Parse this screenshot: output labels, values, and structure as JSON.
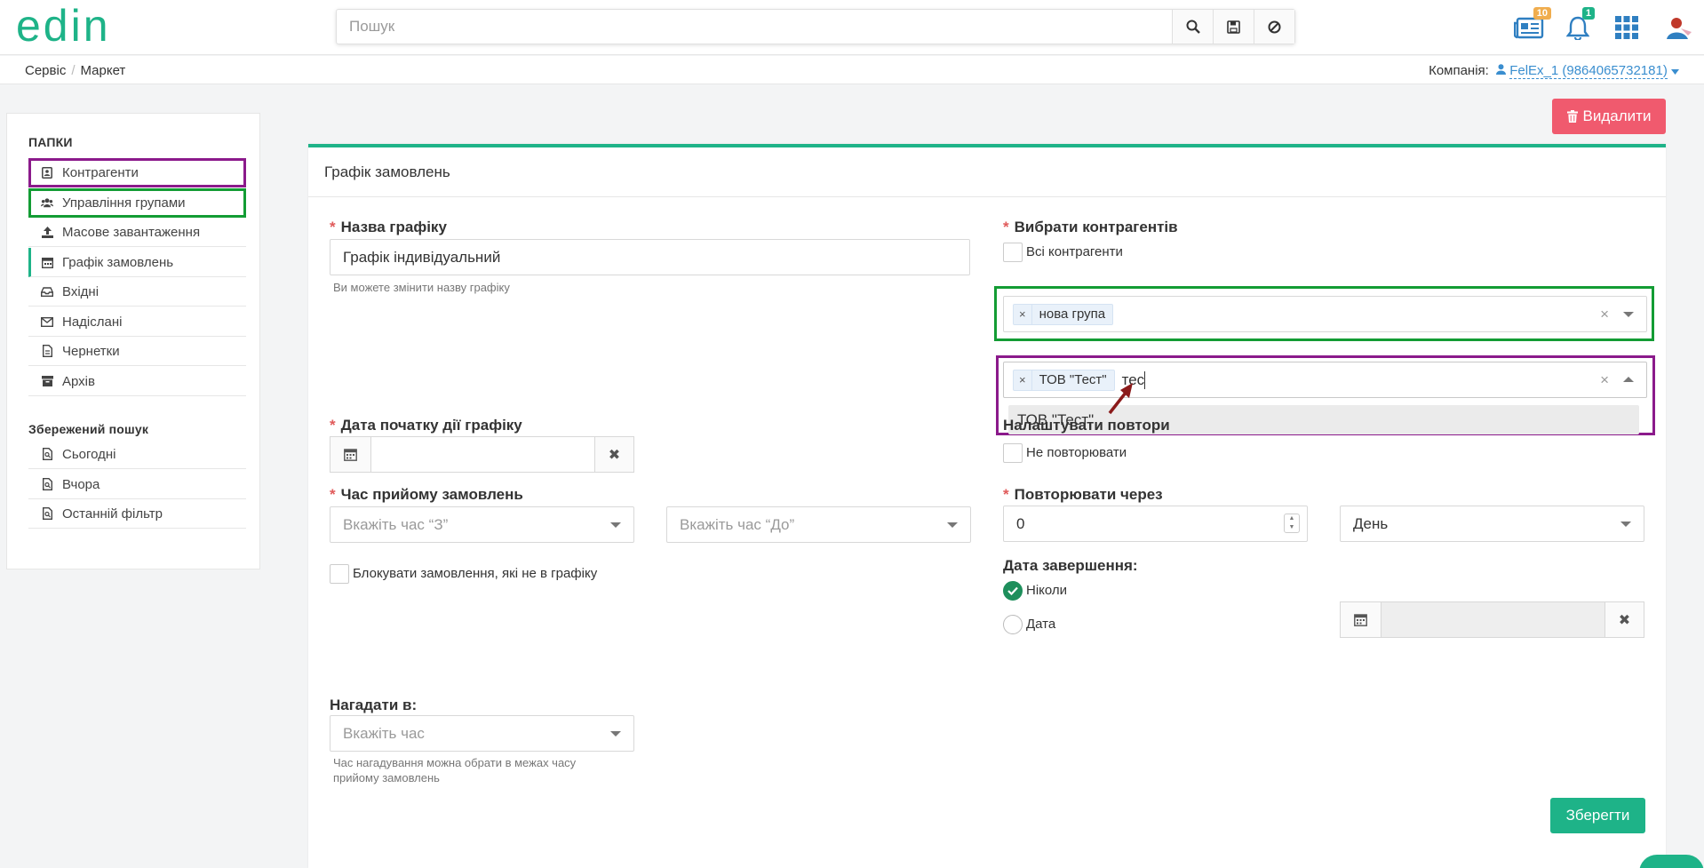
{
  "header": {
    "logo_text": "edin",
    "search": {
      "placeholder": "Пошук"
    },
    "badges": {
      "documents": "10",
      "notifications": "1"
    }
  },
  "breadcrumb": {
    "items": [
      "Сервіс",
      "Маркет"
    ]
  },
  "company": {
    "label": "Компанія:",
    "value": "FelEx_1 (9864065732181)"
  },
  "sidebar": {
    "folders_title": "ПАПКИ",
    "items": [
      {
        "label": "Контрагенти",
        "icon": "address-card-icon"
      },
      {
        "label": "Управління групами",
        "icon": "users-icon"
      },
      {
        "label": "Масове завантаження",
        "icon": "upload-icon"
      },
      {
        "label": "Графік замовлень",
        "icon": "calendar-icon"
      },
      {
        "label": "Вхідні",
        "icon": "inbox-icon"
      },
      {
        "label": "Надіслані",
        "icon": "envelope-icon"
      },
      {
        "label": "Чернетки",
        "icon": "file-icon"
      },
      {
        "label": "Архів",
        "icon": "archive-icon"
      }
    ],
    "saved_title": "Збережений пошук",
    "saved_items": [
      {
        "label": "Сьогодні"
      },
      {
        "label": "Вчора"
      },
      {
        "label": "Останній фільтр"
      }
    ]
  },
  "actions": {
    "delete_label": "Видалити",
    "save_label": "Зберегти"
  },
  "form": {
    "title": "Графік замовлень",
    "schedule_name": {
      "label": "Назва графіку",
      "value": "Графік індивідуальний",
      "hint": "Ви можете змінити назву графіку"
    },
    "counterparties": {
      "label": "Вибрати контрагентів",
      "all_label": "Всі контрагенти",
      "group_tag": "нова група",
      "company_tag": "ТОВ \"Тест\"",
      "search_text": "тес",
      "dropdown_option": "ТОВ \"Тест\""
    },
    "start_date": {
      "label": "Дата початку дії графіку",
      "value": ""
    },
    "repeat_settings": {
      "label": "Налаштувати повтори",
      "no_repeat_label": "Не повторювати"
    },
    "order_time": {
      "label": "Час прийому замовлень",
      "from_placeholder": "Вкажіть час “З”",
      "to_placeholder": "Вкажіть час “До”"
    },
    "repeat_every": {
      "label": "Повторювати через",
      "value": "0",
      "unit": "День"
    },
    "block_orders_label": "Блокувати замовлення, які не в графіку",
    "end_date": {
      "label": "Дата завершення:",
      "never_label": "Ніколи",
      "date_label": "Дата",
      "never_selected": true
    },
    "remind": {
      "label": "Нагадати в:",
      "placeholder": "Вкажіть час",
      "hint": "Час нагадування можна обрати в межах часу прийому замовлень"
    }
  },
  "colors": {
    "accent": "#1eb388",
    "danger": "#f05a6e",
    "highlight_green": "#139c34",
    "highlight_purple": "#8b1a8b",
    "link": "#3a8ecf",
    "annotation_arrow": "#8b1a1a"
  }
}
